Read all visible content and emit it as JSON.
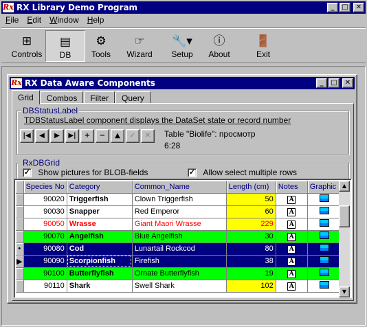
{
  "window": {
    "title": "RX Library Demo Program"
  },
  "menu": [
    {
      "label": "File",
      "accel": "F",
      "rest": "ile"
    },
    {
      "label": "Edit",
      "accel": "E",
      "rest": "dit"
    },
    {
      "label": "Window",
      "accel": "W",
      "rest": "indow"
    },
    {
      "label": "Help",
      "accel": "H",
      "rest": "elp"
    }
  ],
  "toolbar": {
    "controls": "Controls",
    "db": "DB",
    "tools": "Tools",
    "wizard": "Wizard",
    "setup": "Setup",
    "about": "About",
    "exit": "Exit"
  },
  "child": {
    "title": "RX Data Aware Components",
    "tabs": [
      "Grid",
      "Combos",
      "Filter",
      "Query"
    ],
    "active_tab": "Grid"
  },
  "status_group": {
    "legend": "DBStatusLabel",
    "description": "TDBStatusLabel component displays the DataSet state or record number",
    "state_text": "Table \"Biolife\": просмотр",
    "record_text": "6:28"
  },
  "grid_group": {
    "legend": "RxDBGrid",
    "show_pictures_label": "Show pictures for BLOB-fields",
    "show_pictures_checked": true,
    "multi_select_label": "Allow select multiple rows",
    "multi_select_checked": true
  },
  "grid": {
    "columns": [
      "Species No",
      "Category",
      "Common_Name",
      "Length (cm)",
      "Notes",
      "Graphic"
    ],
    "rows": [
      {
        "species": "90020",
        "category": "Triggerfish",
        "common": "Clown Triggerfish",
        "length": "50",
        "style": "normal",
        "indicator": ""
      },
      {
        "species": "90030",
        "category": "Snapper",
        "common": "Red Emperor",
        "length": "60",
        "style": "normal",
        "indicator": ""
      },
      {
        "species": "90050",
        "category": "Wrasse",
        "common": "Giant Maori Wrasse",
        "length": "229",
        "style": "red",
        "indicator": ""
      },
      {
        "species": "90070",
        "category": "Angelfish",
        "common": "Blue Angelfish",
        "length": "30",
        "style": "green",
        "indicator": ""
      },
      {
        "species": "90080",
        "category": "Cod",
        "common": "Lunartail Rockcod",
        "length": "80",
        "style": "selected",
        "indicator": "•"
      },
      {
        "species": "90090",
        "category": "Scorpionfish",
        "common": "Firefish",
        "length": "38",
        "style": "selected",
        "indicator": "▶"
      },
      {
        "species": "90100",
        "category": "Butterflyfish",
        "common": "Ornate Butterflyfish",
        "length": "19",
        "style": "green",
        "indicator": ""
      },
      {
        "species": "90110",
        "category": "Shark",
        "common": "Swell Shark",
        "length": "102",
        "style": "normal",
        "indicator": ""
      }
    ]
  },
  "colors": {
    "titlebar": "#000080",
    "selected_row": "#000080",
    "green_row": "#00ff00",
    "yellow_cell": "#ffff00",
    "red_text": "#ff0000"
  }
}
